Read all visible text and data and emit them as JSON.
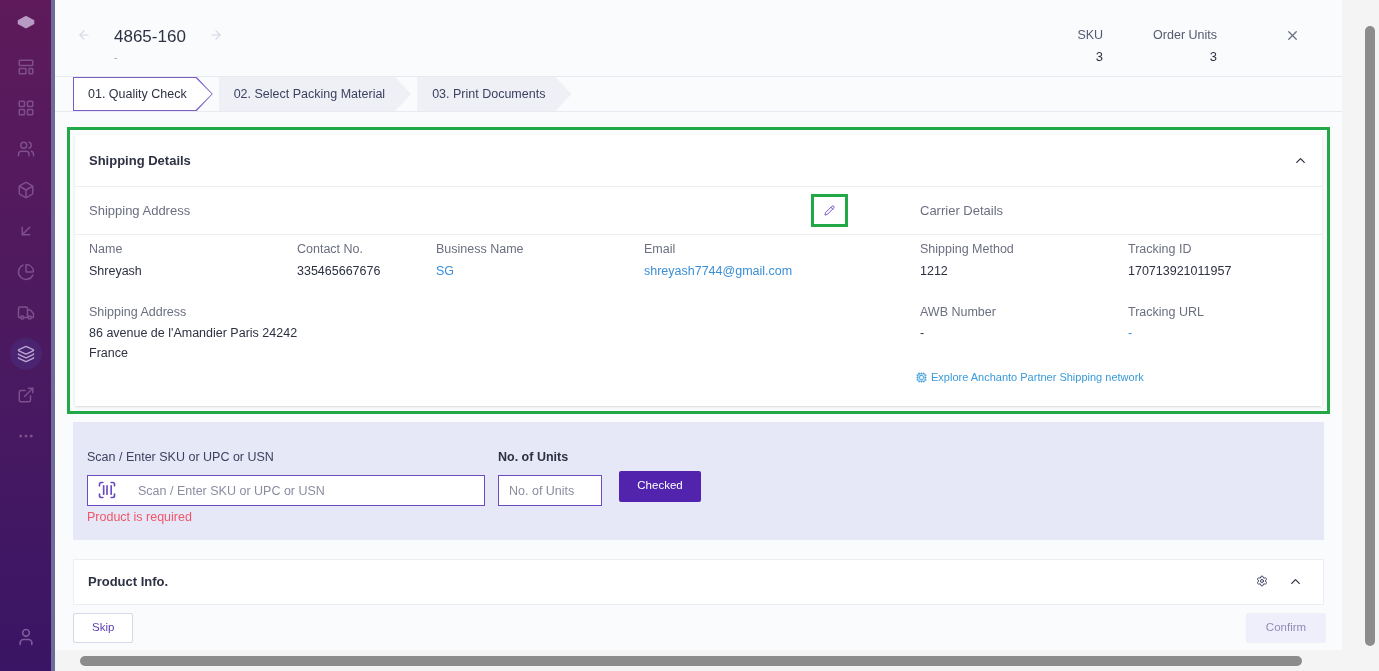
{
  "sidebar": {
    "items": [
      {
        "kind": "layout",
        "selected": false
      },
      {
        "kind": "grid",
        "selected": false
      },
      {
        "kind": "users",
        "selected": false
      },
      {
        "kind": "box",
        "selected": false
      },
      {
        "kind": "inbound",
        "selected": false
      },
      {
        "kind": "chart",
        "selected": false
      },
      {
        "kind": "truck",
        "selected": false
      },
      {
        "kind": "layers",
        "selected": true
      },
      {
        "kind": "external",
        "selected": false
      },
      {
        "kind": "more",
        "selected": false
      }
    ]
  },
  "header": {
    "title": "4865-160",
    "subtitle": "-",
    "stats": [
      {
        "label": "SKU",
        "value": "3"
      },
      {
        "label": "Order Units",
        "value": "3"
      }
    ]
  },
  "steps": [
    {
      "label": "01. Quality Check",
      "selected": true
    },
    {
      "label": "02. Select Packing Material",
      "selected": false
    },
    {
      "label": "03. Print Documents",
      "selected": false
    }
  ],
  "shipping": {
    "title": "Shipping Details",
    "expanded": true,
    "highlighted": true,
    "address_heading": "Shipping Address",
    "edit_highlighted": true,
    "carrier_heading": "Carrier Details",
    "address_fields": [
      {
        "label": "Name",
        "value": "Shreyash",
        "link": false
      },
      {
        "label": "Contact No.",
        "value": "335465667676",
        "link": false
      },
      {
        "label": "Business Name",
        "value": "SG",
        "link": true
      },
      {
        "label": "Email",
        "value": "shreyash7744@gmail.com",
        "link": true
      }
    ],
    "address": {
      "label": "Shipping Address",
      "lines": [
        "86 avenue de l'Amandier Paris 24242",
        "France"
      ]
    },
    "carrier_fields": [
      {
        "label": "Shipping Method",
        "value": "1212",
        "link": false
      },
      {
        "label": "Tracking ID",
        "value": "170713921011957",
        "link": false
      },
      {
        "label": "AWB Number",
        "value": "-",
        "link": false
      },
      {
        "label": "Tracking URL",
        "value": "-",
        "link": true
      }
    ],
    "network_link": "Explore Anchanto Partner Shipping network"
  },
  "scan": {
    "label": "Scan / Enter SKU or UPC or USN",
    "placeholder": "Scan / Enter SKU or UPC or USN",
    "error": "Product is required",
    "units_label": "No. of Units",
    "units_placeholder": "No. of Units",
    "button": "Checked"
  },
  "product_info": {
    "title": "Product Info.",
    "expanded": true
  },
  "footer": {
    "skip": "Skip",
    "confirm": {
      "label": "Confirm",
      "disabled": true
    }
  }
}
